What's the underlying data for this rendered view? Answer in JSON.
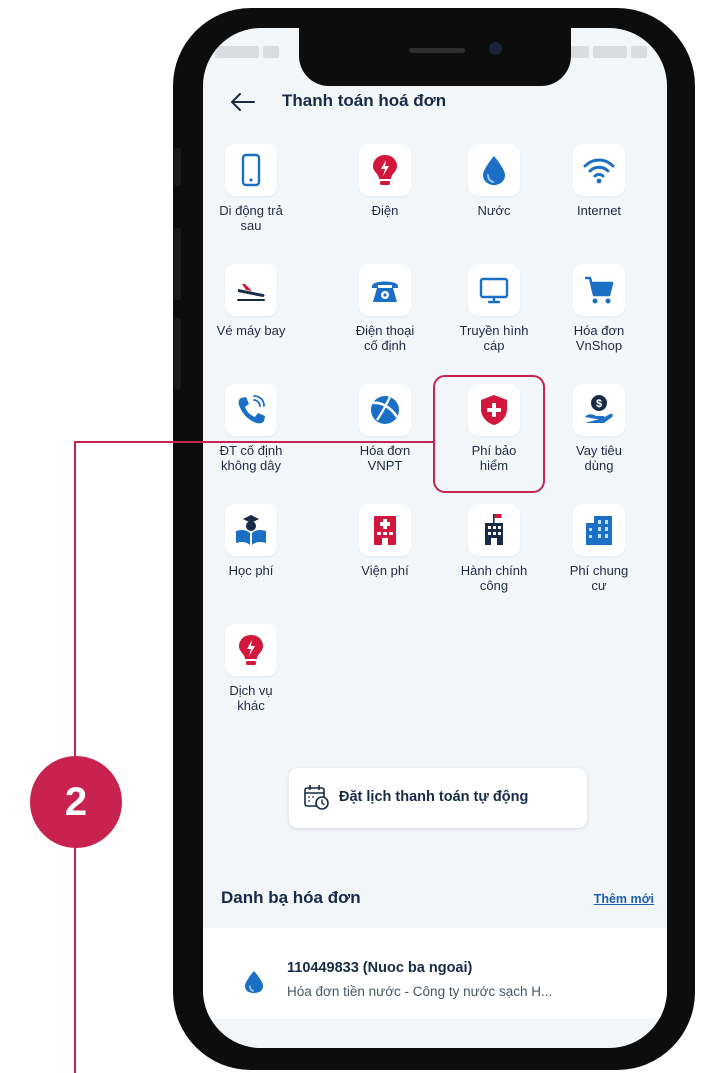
{
  "header": {
    "title": "Thanh toán hoá đơn"
  },
  "services": [
    {
      "label": "Di động trả\nsau",
      "icon": "mobile-phone-icon"
    },
    {
      "label": "Điện",
      "icon": "lightbulb-icon"
    },
    {
      "label": "Nước",
      "icon": "water-drop-icon"
    },
    {
      "label": "Internet",
      "icon": "wifi-icon"
    },
    {
      "label": "Vé máy bay",
      "icon": "airplane-icon"
    },
    {
      "label": "Điện thoại\ncố định",
      "icon": "landline-phone-icon"
    },
    {
      "label": "Truyền hình\ncáp",
      "icon": "tv-icon"
    },
    {
      "label": "Hóa đơn\nVnShop",
      "icon": "shopping-cart-icon"
    },
    {
      "label": "ĐT cố định\nkhông dây",
      "icon": "wireless-phone-icon"
    },
    {
      "label": "Hóa đơn\nVNPT",
      "icon": "vnpt-logo-icon"
    },
    {
      "label": "Phí bảo\nhiểm",
      "icon": "shield-cross-icon"
    },
    {
      "label": "Vay tiêu\ndùng",
      "icon": "loan-hand-icon"
    },
    {
      "label": "Học phí",
      "icon": "graduate-book-icon"
    },
    {
      "label": "Viện phí",
      "icon": "hospital-icon"
    },
    {
      "label": "Hành chính\ncông",
      "icon": "government-building-icon"
    },
    {
      "label": "Phí chung\ncư",
      "icon": "apartment-building-icon"
    },
    {
      "label": "Dịch vụ\nkhác",
      "icon": "lightbulb-icon"
    }
  ],
  "schedule_button": {
    "label": "Đặt lịch thanh toán tự động",
    "icon": "calendar-clock-icon"
  },
  "directory": {
    "title": "Danh bạ hóa đơn",
    "add_link": "Thêm mới",
    "bills": [
      {
        "name": "110449833 (Nuoc ba ngoai)",
        "description": "Hóa đơn tiền nước - Công ty nước sạch H...",
        "icon": "water-drop-icon"
      }
    ]
  },
  "annotation": {
    "step": "2",
    "highlighted_item": "Phí bảo hiểm"
  },
  "colors": {
    "primary_navy": "#172b47",
    "accent_red": "#d1173b",
    "accent_blue": "#1b6fc4",
    "annotation": "#c8234e",
    "screen_bg": "#f3f6f9"
  }
}
